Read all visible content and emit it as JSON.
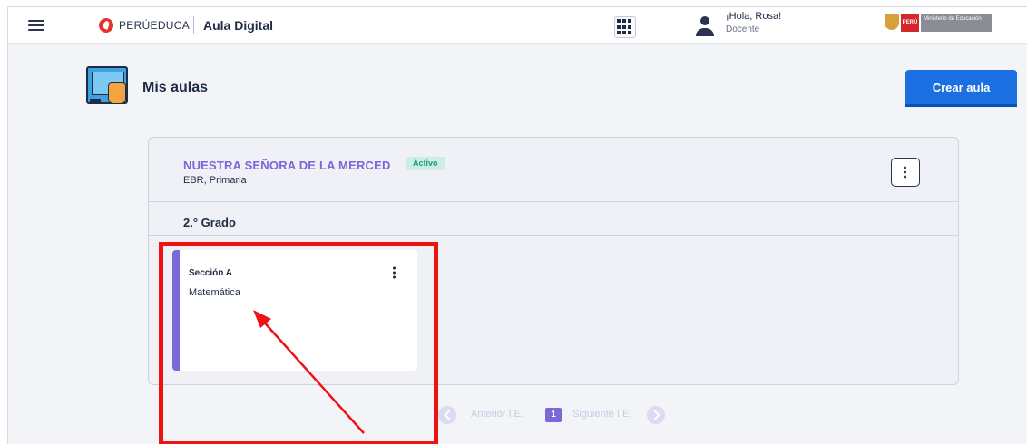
{
  "header": {
    "brand": "PERÚEDUCA",
    "app_title": "Aula Digital",
    "user_greeting": "¡Hola, Rosa!",
    "user_role": "Docente",
    "minedu_country": "PERÚ",
    "minedu_org": "Ministerio de Educación"
  },
  "page": {
    "title": "Mis aulas",
    "create_button": "Crear aula"
  },
  "school": {
    "name": "NUESTRA SEÑORA DE LA MERCED",
    "status": "Activo",
    "level": "EBR, Primaria",
    "grade": "2.° Grado",
    "sections": [
      {
        "name": "Sección A",
        "course": "Matemática"
      }
    ]
  },
  "pagination": {
    "prev_label": "Anterior I.E.",
    "current_page": "1",
    "next_label": "Siguiente I.E."
  },
  "colors": {
    "accent_purple": "#7a67d8",
    "primary_blue": "#1c6fe0",
    "annotation_red": "#ee1212",
    "active_badge_green": "#1f9a76"
  }
}
